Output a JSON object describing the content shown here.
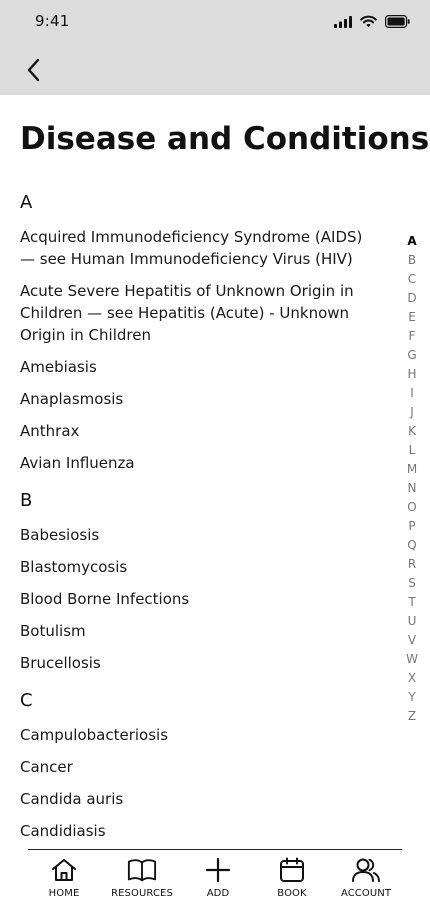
{
  "status_bar": {
    "time": "9:41",
    "icons": [
      "cellular-signal-icon",
      "wifi-icon",
      "battery-icon"
    ]
  },
  "header": {
    "back_icon": "chevron-left-icon"
  },
  "page": {
    "title": "Disease and Conditions"
  },
  "sections": [
    {
      "letter": "A",
      "items": [
        "Acquired Immunodeficiency Syndrome (AIDS) — see Human Immunodeficiency Virus (HIV)",
        "Acute Severe Hepatitis of Unknown Origin in Children — see Hepatitis (Acute) - Unknown Origin in Children",
        "Amebiasis",
        "Anaplasmosis",
        "Anthrax",
        "Avian Influenza"
      ]
    },
    {
      "letter": "B",
      "items": [
        "Babesiosis",
        "Blastomycosis",
        "Blood Borne Infections",
        "Botulism",
        "Brucellosis"
      ]
    },
    {
      "letter": "C",
      "items": [
        "Campulobacteriosis",
        "Cancer",
        "Candida auris",
        "Candidiasis"
      ]
    }
  ],
  "alphabet_index": {
    "active": "A",
    "letters": [
      "A",
      "B",
      "C",
      "D",
      "E",
      "F",
      "G",
      "H",
      "I",
      "J",
      "K",
      "L",
      "M",
      "N",
      "O",
      "P",
      "Q",
      "R",
      "S",
      "T",
      "U",
      "V",
      "W",
      "X",
      "Y",
      "Z"
    ]
  },
  "bottom_nav": [
    {
      "label": "HOME",
      "icon": "home-icon"
    },
    {
      "label": "RESOURCES",
      "icon": "book-open-icon"
    },
    {
      "label": "ADD",
      "icon": "plus-icon"
    },
    {
      "label": "BOOK",
      "icon": "calendar-icon"
    },
    {
      "label": "ACCOUNT",
      "icon": "users-icon"
    }
  ]
}
